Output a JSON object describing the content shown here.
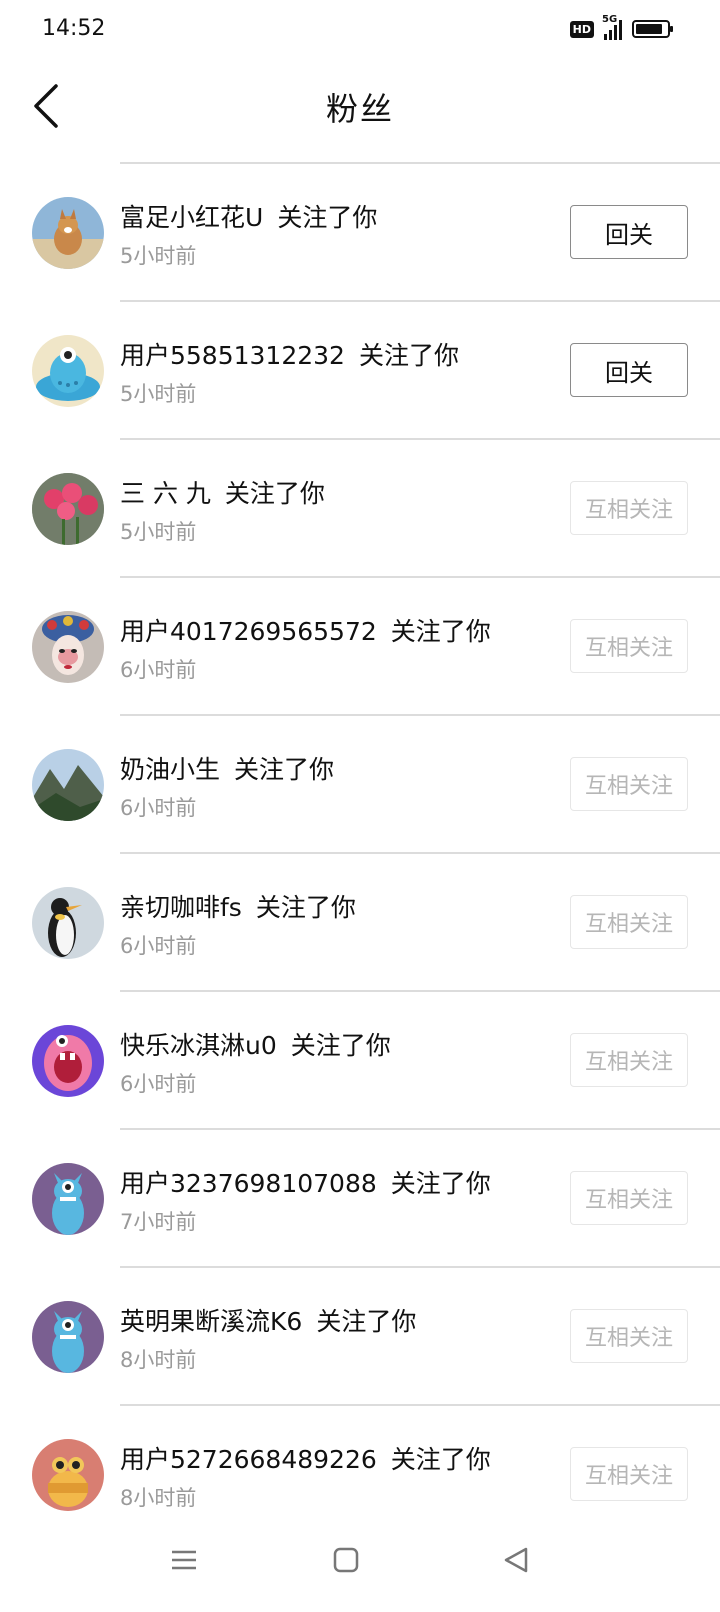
{
  "status": {
    "time": "14:52",
    "hd": "HD",
    "network": "5G"
  },
  "header": {
    "title": "粉丝"
  },
  "followers": [
    {
      "name": "富足小红花U",
      "action": "关注了你",
      "time": "5小时前",
      "button": "回关",
      "button_style": "primary",
      "avatar_icon": "dog-avatar"
    },
    {
      "name": "用户55851312232",
      "action": "关注了你",
      "time": "5小时前",
      "button": "回关",
      "button_style": "primary",
      "avatar_icon": "blue-monster-avatar"
    },
    {
      "name": "三 六 九",
      "action": "关注了你",
      "time": "5小时前",
      "button": "互相关注",
      "button_style": "muted",
      "avatar_icon": "roses-avatar"
    },
    {
      "name": "用户4017269565572",
      "action": "关注了你",
      "time": "6小时前",
      "button": "互相关注",
      "button_style": "muted",
      "avatar_icon": "opera-mask-avatar"
    },
    {
      "name": "奶油小生",
      "action": "关注了你",
      "time": "6小时前",
      "button": "互相关注",
      "button_style": "muted",
      "avatar_icon": "mountain-avatar"
    },
    {
      "name": "亲切咖啡fs",
      "action": "关注了你",
      "time": "6小时前",
      "button": "互相关注",
      "button_style": "muted",
      "avatar_icon": "penguin-avatar"
    },
    {
      "name": "快乐冰淇淋u0",
      "action": "关注了你",
      "time": "6小时前",
      "button": "互相关注",
      "button_style": "muted",
      "avatar_icon": "pink-monster-avatar"
    },
    {
      "name": "用户3237698107088",
      "action": "关注了你",
      "time": "7小时前",
      "button": "互相关注",
      "button_style": "muted",
      "avatar_icon": "blue-monster-purple-avatar"
    },
    {
      "name": "英明果断溪流K6",
      "action": "关注了你",
      "time": "8小时前",
      "button": "互相关注",
      "button_style": "muted",
      "avatar_icon": "blue-monster-purple-avatar"
    },
    {
      "name": "用户5272668489226",
      "action": "关注了你",
      "time": "8小时前",
      "button": "互相关注",
      "button_style": "muted",
      "avatar_icon": "orange-monster-avatar"
    }
  ],
  "system_nav": {
    "items": [
      "menu-icon",
      "home-square-icon",
      "back-triangle-icon"
    ]
  }
}
